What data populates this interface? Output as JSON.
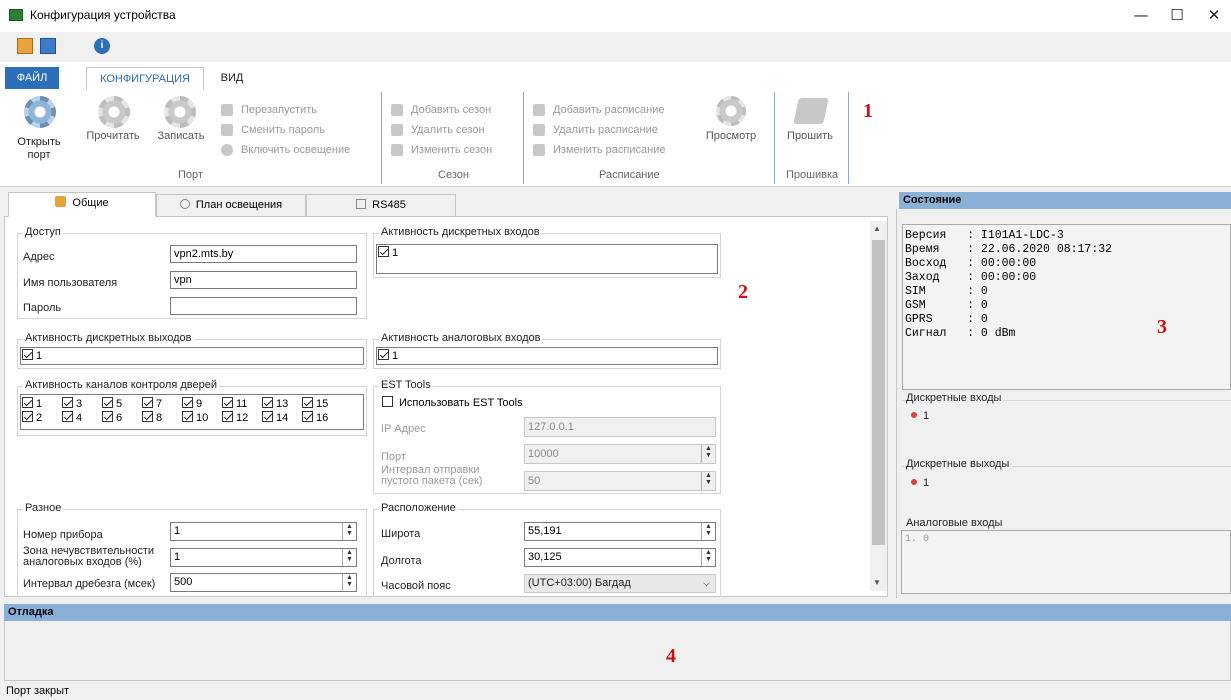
{
  "window": {
    "title": "Конфигурация устройства",
    "min": "—",
    "max": "☐",
    "close": "✕"
  },
  "ribbon_tabs": {
    "file": "ФАЙЛ",
    "config": "КОНФИГУРАЦИЯ",
    "view": "ВИД"
  },
  "ribbon": {
    "open_port": "Открыть порт",
    "read": "Прочитать",
    "write": "Записать",
    "restart": "Перезапустить",
    "change_password": "Сменить пароль",
    "light_on": "Включить освещение",
    "group_port": "Порт",
    "add_season": "Добавить сезон",
    "delete_season": "Удалить сезон",
    "edit_season": "Изменить сезон",
    "group_season": "Сезон",
    "add_schedule": "Добавить расписание",
    "delete_schedule": "Удалить расписание",
    "edit_schedule": "Изменить расписание",
    "view": "Просмотр",
    "group_schedule": "Расписание",
    "flash": "Прошить",
    "group_flash": "Прошивка"
  },
  "annotations": {
    "a1": "1",
    "a2": "2",
    "a3": "3",
    "a4": "4"
  },
  "content_tabs": {
    "general": "Общие",
    "light_plan": "План освещения",
    "rs485": "RS485"
  },
  "access": {
    "legend": "Доступ",
    "address_label": "Адрес",
    "address": "vpn2.mts.by",
    "user_label": "Имя пользователя",
    "user": "vpn",
    "password_label": "Пароль",
    "password": ""
  },
  "discrete_in": {
    "legend": "Активность дискретных входов",
    "item": "1"
  },
  "discrete_out": {
    "legend": "Активность дискретных выходов",
    "item": "1"
  },
  "analog_in": {
    "legend": "Активность аналоговых входов",
    "item": "1"
  },
  "door_channels": {
    "legend": "Активность каналов контроля дверей",
    "items": [
      "1",
      "2",
      "3",
      "4",
      "5",
      "6",
      "7",
      "8",
      "9",
      "10",
      "11",
      "12",
      "13",
      "14",
      "15",
      "16"
    ]
  },
  "est": {
    "legend": "EST Tools",
    "use": "Использовать EST Tools",
    "ip_label": "IP Адрес",
    "ip": "127.0.0.1",
    "port_label": "Порт",
    "port": "10000",
    "interval_label": "Интервал отправки пустого пакета (сек)",
    "interval": "50"
  },
  "misc": {
    "legend": "Разное",
    "device_no_label": "Номер прибора",
    "device_no": "1",
    "deadzone_label": "Зона нечувствительности аналоговых входов (%)",
    "deadzone": "1",
    "bounce_label": "Интервал дребезга (мсек)",
    "bounce": "500"
  },
  "location": {
    "legend": "Расположение",
    "lat_label": "Широта",
    "lat": "55,191",
    "lon_label": "Долгота",
    "lon": "30,125",
    "tz_label": "Часовой пояс",
    "tz": "(UTC+03:00) Багдад"
  },
  "state": {
    "header": "Состояние",
    "rows": [
      "Версия   : I101A1-LDC-3",
      "Время    : 22.06.2020 08:17:32",
      "Восход   : 00:00:00",
      "Заход    : 00:00:00",
      "SIM      : 0",
      "GSM      : 0",
      "GPRS     : 0",
      "Сигнал   : 0 dBm"
    ],
    "din_label": "Дискретные входы",
    "din_item": "1",
    "dout_label": "Дискретные выходы",
    "dout_item": "1",
    "ain_label": "Аналоговые входы",
    "ain_value": "1. 0"
  },
  "debug": {
    "header": "Отладка"
  },
  "statusbar": {
    "text": "Порт закрыт"
  }
}
